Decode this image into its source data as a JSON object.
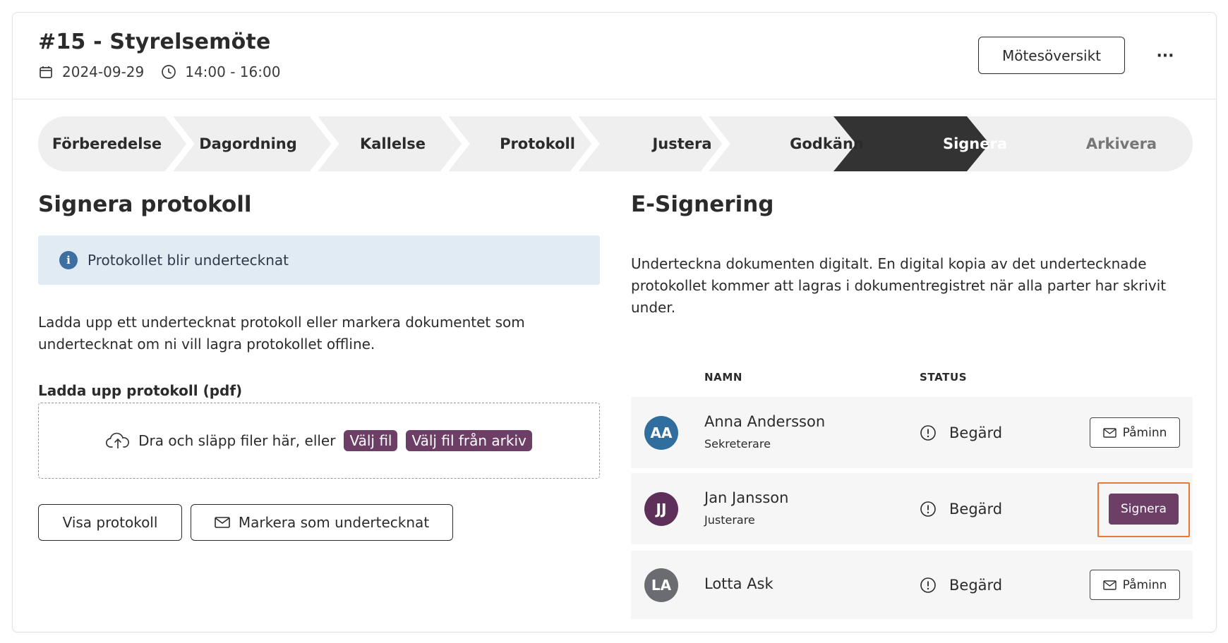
{
  "meeting": {
    "title": "#15 - Styrelsemöte",
    "date": "2024-09-29",
    "time": "14:00 - 16:00",
    "overview_label": "Mötesöversikt",
    "more_label": "···"
  },
  "stepper": {
    "steps": [
      "Förberedelse",
      "Dagordning",
      "Kallelse",
      "Protokoll",
      "Justera",
      "Godkänn",
      "Signera",
      "Arkivera"
    ],
    "active_index": 6
  },
  "left": {
    "title": "Signera protokoll",
    "info": "Protokollet blir undertecknat",
    "description_line1": "Ladda upp ett undertecknat protokoll eller markera dokumentet som",
    "description_line2": "undertecknat om ni vill lagra protokollet offline.",
    "upload_label": "Ladda upp protokoll (pdf)",
    "dropzone_text": "Dra och släpp filer här, eller",
    "choose_file": "Välj fil",
    "choose_from_archive": "Välj fil från arkiv",
    "view_button": "Visa protokoll",
    "mark_button": "Markera som undertecknat"
  },
  "right": {
    "title": "E-Signering",
    "description_line1": "Underteckna dokumenten digitalt. En digital kopia av det undertecknade",
    "description_line2": "protokollet kommer att lagras i dokumentregistret när alla parter har skrivit",
    "description_line3": "under.",
    "col_name": "NAMN",
    "col_status": "STATUS",
    "signers": [
      {
        "initials": "AA",
        "name": "Anna Andersson",
        "role": "Sekreterare",
        "status": "Begärd",
        "action": "Påminn",
        "avatar_color": "#2f6e9e"
      },
      {
        "initials": "JJ",
        "name": "Jan Jansson",
        "role": "Justerare",
        "status": "Begärd",
        "action": "Signera",
        "avatar_color": "#5e2f59"
      },
      {
        "initials": "LA",
        "name": "Lotta Ask",
        "role": "",
        "status": "Begärd",
        "action": "Påminn",
        "avatar_color": "#6b6b72"
      }
    ]
  },
  "colors": {
    "accent": "#6d3f67",
    "active_step": "#333333",
    "step_bg": "#efefef",
    "info_bg": "#e1ebf3",
    "highlight": "#e87a36"
  }
}
